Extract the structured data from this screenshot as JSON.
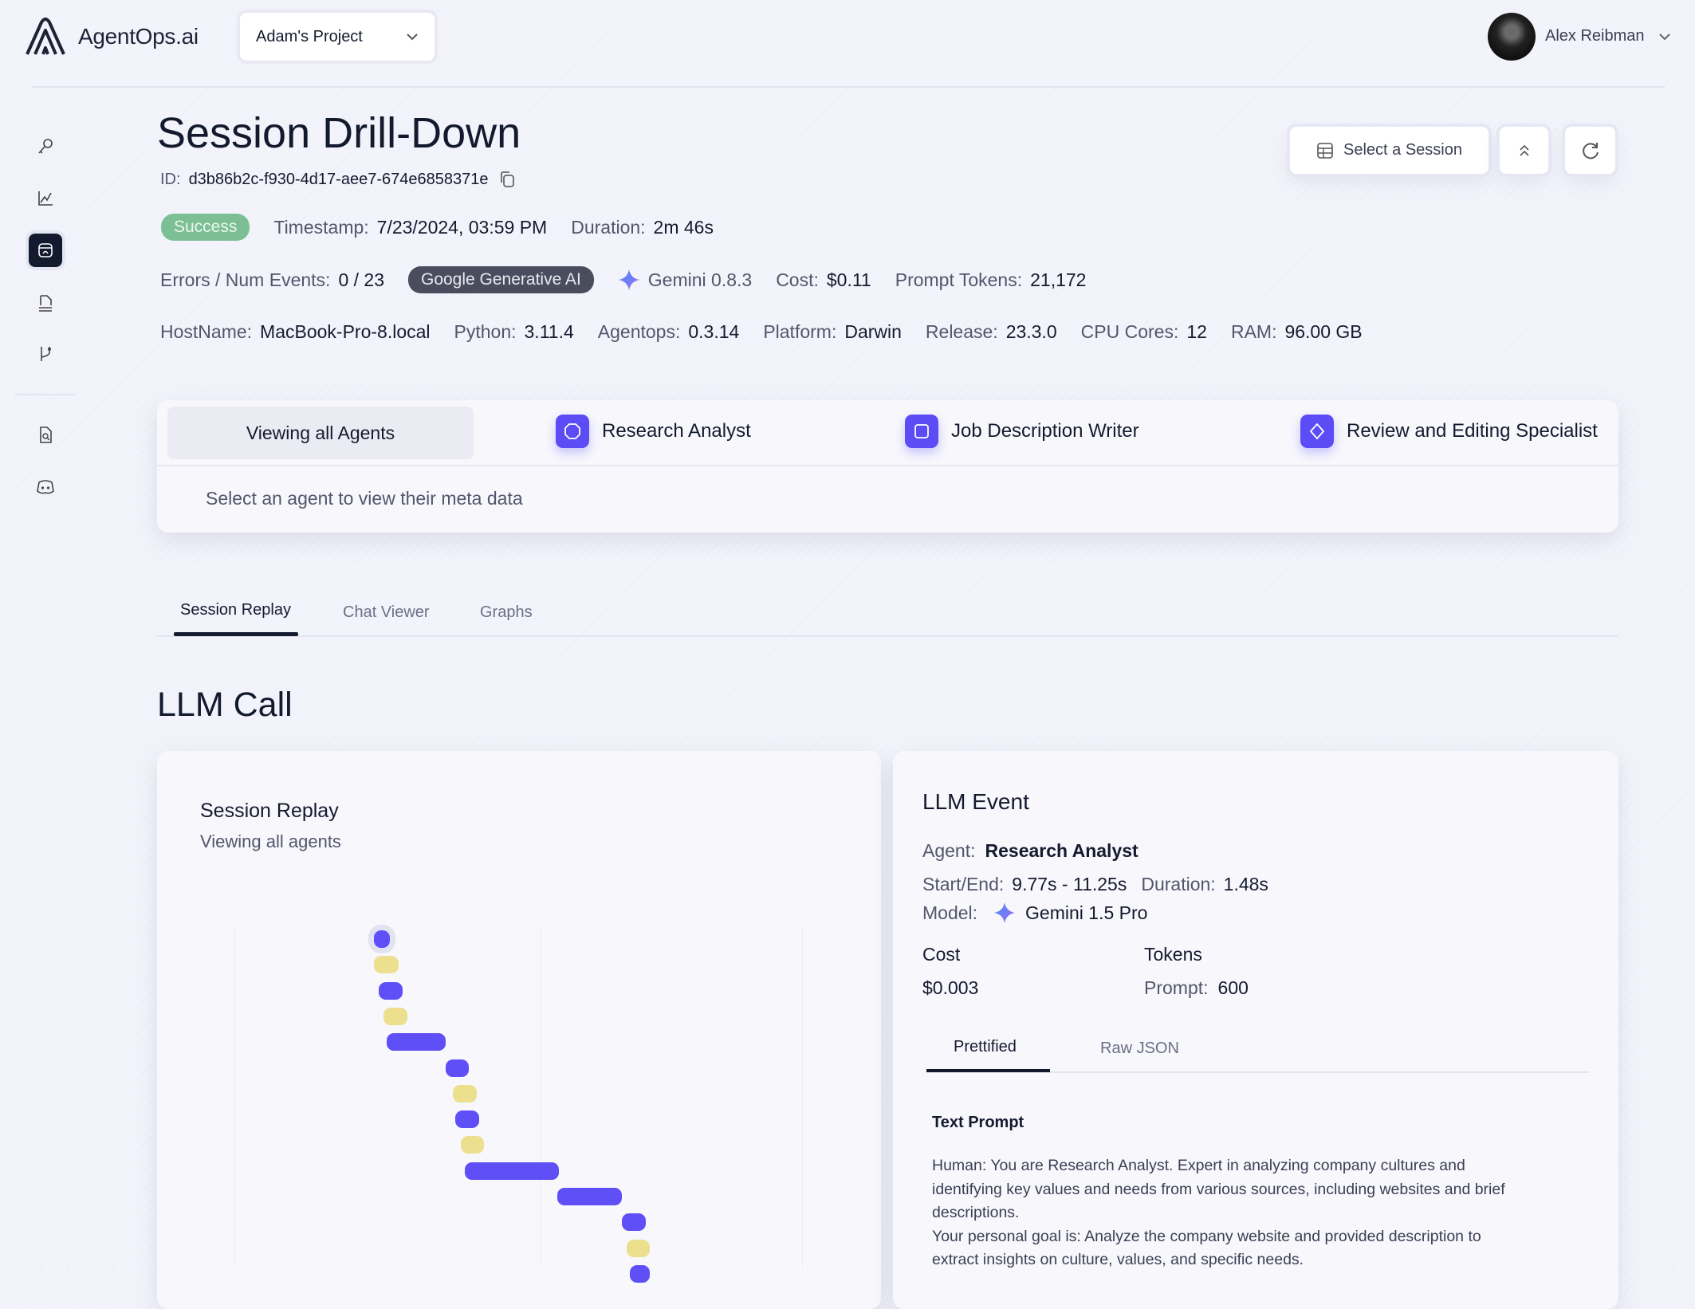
{
  "header": {
    "brand": "AgentOps.ai",
    "project": "Adam's Project",
    "user": "Alex Reibman"
  },
  "sidebar": {
    "icons": [
      "key-icon",
      "chart-icon",
      "session-icon",
      "docs-icon",
      "git-branch-icon",
      "file-search-icon",
      "discord-icon"
    ],
    "active": "session-icon"
  },
  "page": {
    "title": "Session Drill-Down",
    "id_label": "ID:",
    "id": "d3b86b2c-f930-4d17-aee7-674e6858371e",
    "status": "Success",
    "status_color": "#7dbf94",
    "timestamp_label": "Timestamp:",
    "timestamp": "7/23/2024, 03:59 PM",
    "duration_label": "Duration:",
    "duration": "2m 46s",
    "errors_label": "Errors / Num Events:",
    "errors": "0 / 23",
    "provider": "Google Generative AI",
    "sdk": "Gemini 0.8.3",
    "cost_label": "Cost:",
    "cost": "$0.11",
    "prompt_tokens_label": "Prompt Tokens:",
    "prompt_tokens": "21,172",
    "host_label": "HostName:",
    "host": "MacBook-Pro-8.local",
    "python_label": "Python:",
    "python": "3.11.4",
    "agentops_label": "Agentops:",
    "agentops": "0.3.14",
    "platform_label": "Platform:",
    "platform": "Darwin",
    "release_label": "Release:",
    "release": "23.3.0",
    "cpu_label": "CPU Cores:",
    "cpu": "12",
    "ram_label": "RAM:",
    "ram": "96.00 GB"
  },
  "actions": {
    "select_session": "Select a Session"
  },
  "agents": {
    "all": "Viewing all Agents",
    "list": [
      "Research Analyst",
      "Job Description Writer",
      "Review and Editing Specialist"
    ],
    "hint": "Select an agent to view their meta data",
    "accent": "#5b4cf5"
  },
  "tabs": {
    "items": [
      "Session Replay",
      "Chat Viewer",
      "Graphs"
    ],
    "active": "Session Replay"
  },
  "section_title": "LLM Call",
  "replay": {
    "title": "Session Replay",
    "subtitle": "Viewing all agents"
  },
  "chart_data": {
    "type": "timeline",
    "xlim": [
      0,
      166
    ],
    "colors": {
      "llm": "#5f4ff6",
      "tool": "#ece08e"
    },
    "events": [
      {
        "kind": "llm",
        "start": 40.8,
        "end": 45.5,
        "selected": true
      },
      {
        "kind": "tool",
        "start": 40.8,
        "end": 48.1
      },
      {
        "kind": "llm",
        "start": 42.1,
        "end": 49.3
      },
      {
        "kind": "tool",
        "start": 43.6,
        "end": 50.6
      },
      {
        "kind": "llm",
        "start": 44.6,
        "end": 61.7
      },
      {
        "kind": "llm",
        "start": 61.7,
        "end": 68.6
      },
      {
        "kind": "tool",
        "start": 63.9,
        "end": 70.8
      },
      {
        "kind": "llm",
        "start": 64.5,
        "end": 71.5
      },
      {
        "kind": "tool",
        "start": 66.1,
        "end": 73.0
      },
      {
        "kind": "llm",
        "start": 67.4,
        "end": 94.9
      },
      {
        "kind": "llm",
        "start": 94.5,
        "end": 113.2
      },
      {
        "kind": "llm",
        "start": 113.2,
        "end": 120.2
      },
      {
        "kind": "tool",
        "start": 114.8,
        "end": 121.4
      },
      {
        "kind": "llm",
        "start": 115.7,
        "end": 121.4
      }
    ]
  },
  "event": {
    "title": "LLM Event",
    "agent_label": "Agent:",
    "agent": "Research Analyst",
    "startend_label": "Start/End:",
    "startend": "9.77s - 11.25s",
    "duration_label": "Duration:",
    "duration": "1.48s",
    "model_label": "Model:",
    "model": "Gemini 1.5 Pro",
    "cost_label": "Cost",
    "cost": "$0.003",
    "tokens_label": "Tokens",
    "prompt_label": "Prompt:",
    "prompt": "600",
    "tabs": [
      "Prettified",
      "Raw JSON"
    ],
    "prompt_heading": "Text Prompt",
    "prompt_lines": [
      "Human: You are Research Analyst. Expert in analyzing company cultures and",
      "identifying key values and needs from various sources, including websites and brief",
      "descriptions.",
      "Your personal goal is: Analyze the company website and provided description to",
      "extract insights on culture, values, and specific needs."
    ]
  }
}
